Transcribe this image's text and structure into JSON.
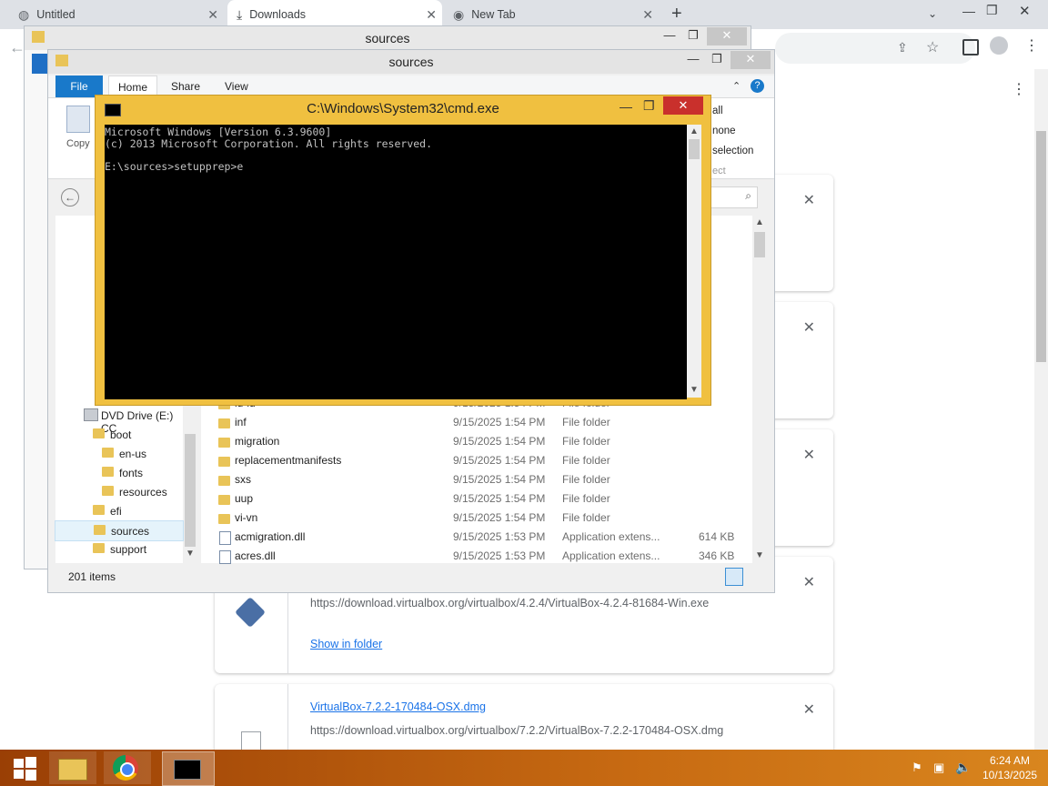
{
  "chrome": {
    "tabs": [
      {
        "label": "Untitled"
      },
      {
        "label": "Downloads"
      },
      {
        "label": "New Tab"
      }
    ],
    "new_tab": "+",
    "window_controls": {
      "minimize": "—",
      "restore": "❐",
      "close": "✕"
    },
    "menu": "⋮"
  },
  "downloads": {
    "cards": [
      {
        "url": "https://download.virtualbox.org/virtualbox/4.2.4/VirtualBox-4.2.4-81684-Win.exe",
        "action": "Show in folder"
      },
      {
        "filename": "VirtualBox-7.2.2-170484-OSX.dmg",
        "url": "https://download.virtualbox.org/virtualbox/7.2.2/VirtualBox-7.2.2-170484-OSX.dmg"
      }
    ],
    "close_glyph": "✕"
  },
  "explorer_back": {
    "title": "sources"
  },
  "explorer": {
    "title": "sources",
    "ribbon_tabs": [
      "File",
      "Home",
      "Share",
      "View"
    ],
    "copy_label": "Copy",
    "select": [
      "all",
      "none",
      "selection",
      "ect"
    ],
    "status": "201 items",
    "tree": [
      {
        "label": "DVD Drive (E:) CC"
      },
      {
        "label": "boot"
      },
      {
        "label": "en-us"
      },
      {
        "label": "fonts"
      },
      {
        "label": "resources"
      },
      {
        "label": "efi"
      },
      {
        "label": "sources"
      },
      {
        "label": "support"
      }
    ],
    "files": [
      {
        "name": "id-id",
        "date": "9/15/2025 1:54 PM",
        "type": "File folder",
        "size": ""
      },
      {
        "name": "inf",
        "date": "9/15/2025 1:54 PM",
        "type": "File folder",
        "size": ""
      },
      {
        "name": "migration",
        "date": "9/15/2025 1:54 PM",
        "type": "File folder",
        "size": ""
      },
      {
        "name": "replacementmanifests",
        "date": "9/15/2025 1:54 PM",
        "type": "File folder",
        "size": ""
      },
      {
        "name": "sxs",
        "date": "9/15/2025 1:54 PM",
        "type": "File folder",
        "size": ""
      },
      {
        "name": "uup",
        "date": "9/15/2025 1:54 PM",
        "type": "File folder",
        "size": ""
      },
      {
        "name": "vi-vn",
        "date": "9/15/2025 1:54 PM",
        "type": "File folder",
        "size": ""
      },
      {
        "name": "acmigration.dll",
        "date": "9/15/2025 1:53 PM",
        "type": "Application extens...",
        "size": "614 KB"
      },
      {
        "name": "acres.dll",
        "date": "9/15/2025 1:53 PM",
        "type": "Application extens...",
        "size": "346 KB"
      }
    ]
  },
  "cmd": {
    "title": "C:\\Windows\\System32\\cmd.exe",
    "lines": [
      "Microsoft Windows [Version 6.3.9600]",
      "(c) 2013 Microsoft Corporation. All rights reserved.",
      "",
      "E:\\sources>setupprep>e"
    ]
  },
  "taskbar": {
    "time": "6:24 AM",
    "date": "10/13/2025"
  }
}
